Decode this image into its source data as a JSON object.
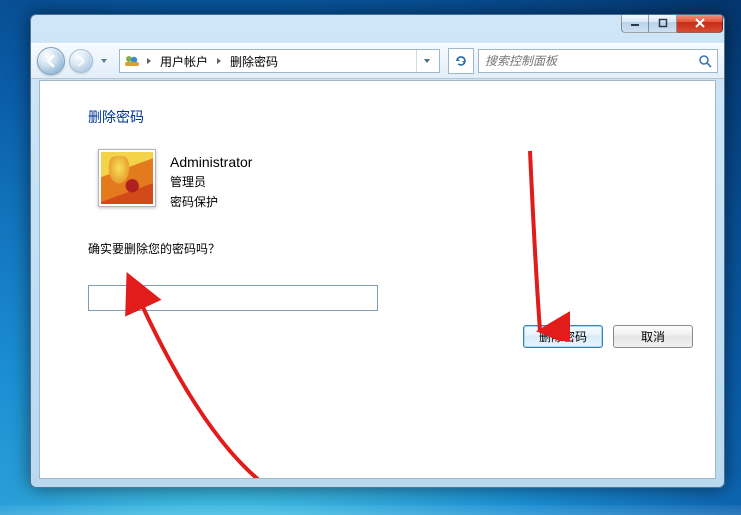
{
  "breadcrumb": {
    "segment1": "用户帐户",
    "segment2": "删除密码"
  },
  "search": {
    "placeholder": "搜索控制面板"
  },
  "page": {
    "title": "删除密码",
    "confirm_text": "确实要删除您的密码吗？"
  },
  "user": {
    "name": "Administrator",
    "role": "管理员",
    "status": "密码保护"
  },
  "password_field": {
    "value": ""
  },
  "buttons": {
    "delete": "删除密码",
    "cancel": "取消"
  }
}
